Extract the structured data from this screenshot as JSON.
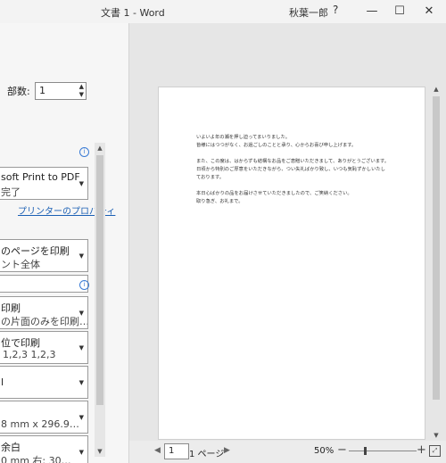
{
  "window": {
    "title": "文書 1  -  Word",
    "user": "秋葉一郎",
    "help": "?",
    "minimize": "—",
    "maximize": "☐",
    "close": "✕"
  },
  "copies": {
    "label": "部数:",
    "value": "1"
  },
  "printer": {
    "name": "soft Print to PDF",
    "status": "完了",
    "properties_link": "プリンターのプロパティ"
  },
  "settings": {
    "range_line1": "のページを印刷",
    "range_line2": "ント全体",
    "sides_line1": "印刷",
    "sides_line2": "の片面のみを印刷…",
    "collate_line1": "位で印刷",
    "collate_line2": "1,2,3    1,2,3",
    "orientation": "l",
    "paper_size": "8 mm x 296.9…",
    "margins_line1": "余白",
    "margins_line2": "0 mm    右: 30…"
  },
  "preview": {
    "lines": [
      "いよいよ年の瀬を押し迫ってまいりました。",
      "皆様にはつつがなく、お過ごしのことと承り、心からお喜び申し上げます。",
      "",
      "また、この度は、はからずも結構なお品をご恵贈いただきまして、ありがとうございます。",
      "日頃から特別のご厚意をいただきながら、つい失礼ばかり致し、いつも気恥ずかしいたし",
      "ております。",
      "",
      "本日心ばかりの品をお届けさせていただきましたので、ご笑納ください。",
      "取り急ぎ、お礼まで。"
    ]
  },
  "status": {
    "current_page": "1",
    "page_label": "1 ページ",
    "zoom": "50%"
  }
}
